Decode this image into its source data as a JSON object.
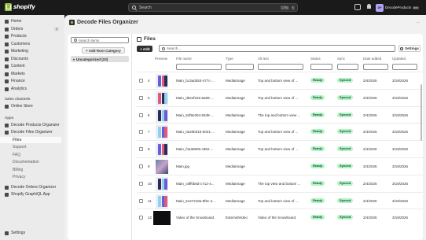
{
  "topbar": {
    "logo_text": "shopify",
    "search_placeholder": "Search",
    "kbd_ctrl": "CTRL",
    "kbd_k": "K",
    "store_initials": "DP",
    "store_name": "DecodeProducts",
    "store_badge": "dev"
  },
  "sidebar": {
    "items": [
      {
        "label": "Home",
        "icon": "home-icon"
      },
      {
        "label": "Orders",
        "icon": "orders-icon",
        "count": "1"
      },
      {
        "label": "Products",
        "icon": "products-icon"
      },
      {
        "label": "Customers",
        "icon": "customers-icon"
      },
      {
        "label": "Marketing",
        "icon": "marketing-icon"
      },
      {
        "label": "Discounts",
        "icon": "discounts-icon"
      },
      {
        "label": "Content",
        "icon": "content-icon"
      },
      {
        "label": "Markets",
        "icon": "markets-icon"
      },
      {
        "label": "Finance",
        "icon": "finance-icon"
      },
      {
        "label": "Analytics",
        "icon": "analytics-icon"
      }
    ],
    "sales_channels_label": "Sales channels",
    "online_store": "Online Store",
    "apps_label": "Apps",
    "apps": [
      {
        "label": "Decode Products Organizer"
      },
      {
        "label": "Decode Files Organizer"
      }
    ],
    "app_subitems": [
      "Files",
      "Support",
      "FAQ",
      "Documentation",
      "Billing",
      "Privacy"
    ],
    "more_apps": [
      "Decode Orders Organizer",
      "Shopify GraphiQL App"
    ],
    "settings": "Settings"
  },
  "app": {
    "title": "Decode Files Organizer",
    "kebab": "···"
  },
  "tree": {
    "search_placeholder": "Search items",
    "add_root": "+ Add Root Category",
    "folder_label": "Uncategorized (23)",
    "caret": "▾"
  },
  "files": {
    "title": "Files",
    "add_button": "+ Add",
    "search_placeholder": "Search...",
    "settings_button": "Settings",
    "columns": [
      "Preview",
      "File name",
      "Type",
      "Alt text",
      "Status",
      "Sync",
      "Date added",
      "Updated"
    ],
    "rows": [
      {
        "num": "4",
        "name": "Main_b13ad453-477c-...",
        "type": "MediaImage",
        "alt": "Top and bottom view of ...",
        "status": "Ready",
        "sync": "Synced",
        "added": "2/4/2026",
        "updated": "3/19/2026",
        "thumb": "phones"
      },
      {
        "num": "5",
        "name": "Main_d624f226-5a89-...",
        "type": "MediaImage",
        "alt": "Top and bottom view of ...",
        "status": "Ready",
        "sync": "Synced",
        "added": "2/4/2026",
        "updated": "3/19/2026",
        "thumb": "phones"
      },
      {
        "num": "6",
        "name": "Main_52f8e304-92d9-...",
        "type": "MediaImage",
        "alt": "The top and bottom view ...",
        "status": "Ready",
        "sync": "Synced",
        "added": "2/4/2026",
        "updated": "3/19/2026",
        "thumb": "phones"
      },
      {
        "num": "7",
        "name": "Main_0a40b01b-5021-...",
        "type": "MediaImage",
        "alt": "Top and bottom view of ...",
        "status": "Ready",
        "sync": "Synced",
        "added": "2/4/2026",
        "updated": "3/19/2026",
        "thumb": "phones"
      },
      {
        "num": "8",
        "name": "Main_f44a9605-c862-...",
        "type": "MediaImage",
        "alt": "Top and bottom view of ...",
        "status": "Ready",
        "sync": "Synced",
        "added": "2/4/2026",
        "updated": "3/19/2026",
        "thumb": "phones"
      },
      {
        "num": "9",
        "name": "Main.jpg",
        "type": "MediaImage",
        "alt": "",
        "status": "Ready",
        "sync": "Synced",
        "added": "2/4/2026",
        "updated": "3/19/2026",
        "thumb": "photo"
      },
      {
        "num": "10",
        "name": "Main_c8ff0b5d-c712-4...",
        "type": "MediaImage",
        "alt": "The top view and bottom ...",
        "status": "Ready",
        "sync": "Synced",
        "added": "2/4/2026",
        "updated": "3/19/2026",
        "thumb": "phones"
      },
      {
        "num": "11",
        "name": "Main_5127218a-8f6c-4...",
        "type": "MediaImage",
        "alt": "Top and bottom view of ...",
        "status": "Ready",
        "sync": "Synced",
        "added": "2/4/2026",
        "updated": "3/19/2026",
        "thumb": "phones"
      },
      {
        "num": "12",
        "name": "Video of the Snowboard.",
        "type": "ExternalVideo",
        "alt": "Video of the Snowboard.",
        "status": "Ready",
        "sync": "Synced",
        "added": "2/4/2026",
        "updated": "3/19/2026",
        "thumb": "dark"
      }
    ]
  },
  "colors": {
    "accent_green": "#95bf47",
    "ready_bg": "#b4f2c5",
    "phone_colors": [
      "#6b5bd6",
      "#e05a7a",
      "#2b2b55",
      "#8fd1f0"
    ]
  }
}
